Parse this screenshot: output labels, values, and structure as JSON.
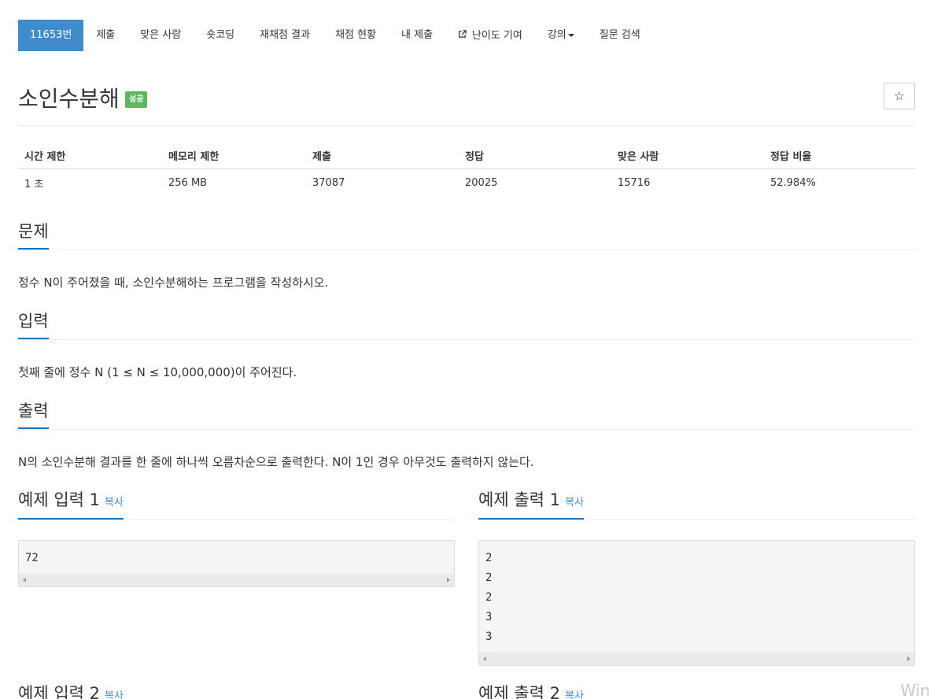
{
  "nav": {
    "items": [
      {
        "label": "11653번"
      },
      {
        "label": "제출"
      },
      {
        "label": "맞은 사람"
      },
      {
        "label": "숏코딩"
      },
      {
        "label": "재채점 결과"
      },
      {
        "label": "채점 현황"
      },
      {
        "label": "내 제출"
      },
      {
        "label": "난이도 기여"
      },
      {
        "label": "강의"
      },
      {
        "label": "질문 검색"
      }
    ]
  },
  "problem": {
    "title": "소인수분해",
    "badge": "성공"
  },
  "info_table": {
    "headers": [
      "시간 제한",
      "메모리 제한",
      "제출",
      "정답",
      "맞은 사람",
      "정답 비율"
    ],
    "values": [
      "1 초",
      "256 MB",
      "37087",
      "20025",
      "15716",
      "52.984%"
    ]
  },
  "sections": {
    "problem_title": "문제",
    "problem_text": "정수 N이 주어졌을 때, 소인수분해하는 프로그램을 작성하시오.",
    "input_title": "입력",
    "input_text": "첫째 줄에 정수 N (1 ≤ N ≤ 10,000,000)이 주어진다.",
    "output_title": "출력",
    "output_text": "N의 소인수분해 결과를 한 줄에 하나씩 오름차순으로 출력한다. N이 1인 경우 아무것도 출력하지 않는다."
  },
  "samples": {
    "copy_label": "복사",
    "input1_title": "예제 입력 1",
    "input1_lines": [
      "72"
    ],
    "output1_title": "예제 출력 1",
    "output1_lines": [
      "2",
      "2",
      "2",
      "3",
      "3"
    ],
    "input2_title": "예제 입력 2",
    "output2_title": "예제 출력 2"
  },
  "overlay": {
    "watermark": "Win"
  }
}
